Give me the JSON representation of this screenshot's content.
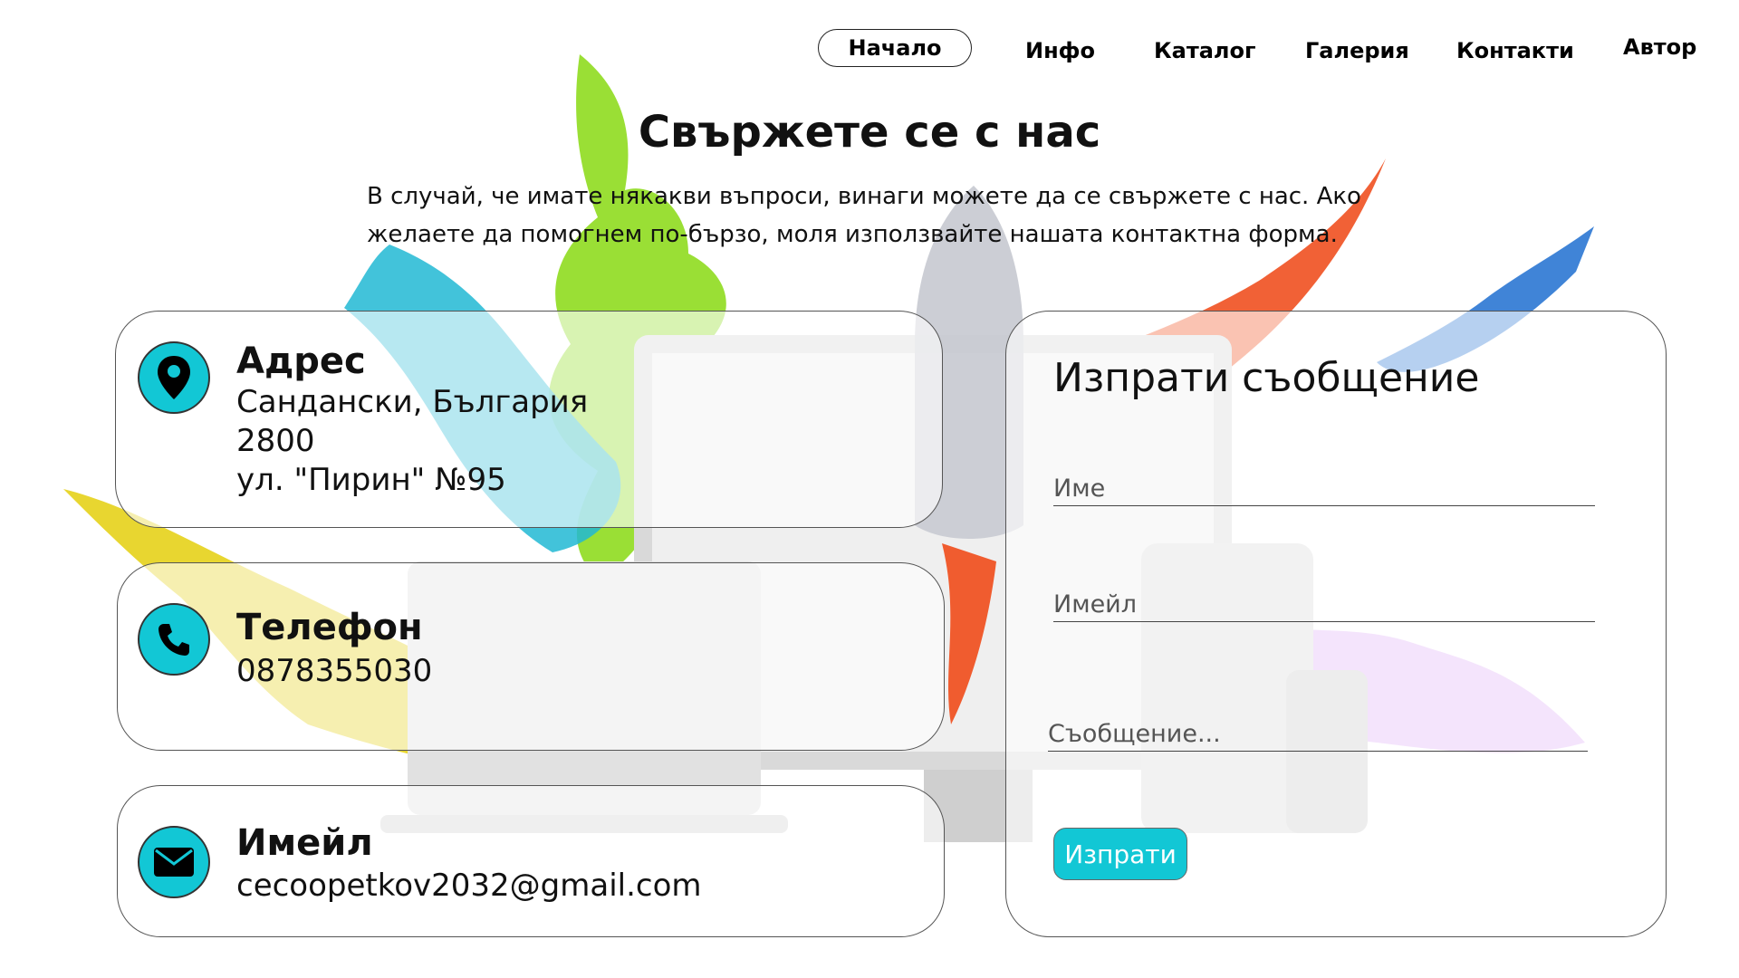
{
  "nav": {
    "items": [
      {
        "label": "Начало",
        "active": true
      },
      {
        "label": "Инфо"
      },
      {
        "label": "Каталог"
      },
      {
        "label": "Галерия"
      },
      {
        "label": "Контакти"
      },
      {
        "label": "Автор"
      }
    ]
  },
  "page": {
    "title": "Свържете се с нас",
    "intro": "В случай, че имате някакви въпроси, винаги можете да се свържете с нас. Ако желаете да помогнем по-бързо, моля използвайте нашата контактна форма."
  },
  "address": {
    "title": "Адрес",
    "line1": "Сандански, България",
    "line2": "2800",
    "line3": "ул. \"Пирин\" №95",
    "icon": "location-pin-icon"
  },
  "phone": {
    "title": "Телефон",
    "number": "0878355030",
    "icon": "phone-icon"
  },
  "email": {
    "title": "Имейл",
    "address": "cecoopetkov2032@gmail.com",
    "icon": "envelope-icon"
  },
  "form": {
    "title": "Изпрати съобщение",
    "name_placeholder": "Име",
    "email_placeholder": "Имейл",
    "message_placeholder": "Съобщение...",
    "submit_label": "Изпрати"
  },
  "colors": {
    "accent": "#12c7d5",
    "splash_green": "#8fdc1f",
    "splash_cyan": "#21b8d3",
    "splash_yellow": "#e6d21a",
    "splash_orange": "#ef4b1a",
    "splash_blue": "#1f6fd0",
    "splash_purple": "#cf8af0"
  }
}
